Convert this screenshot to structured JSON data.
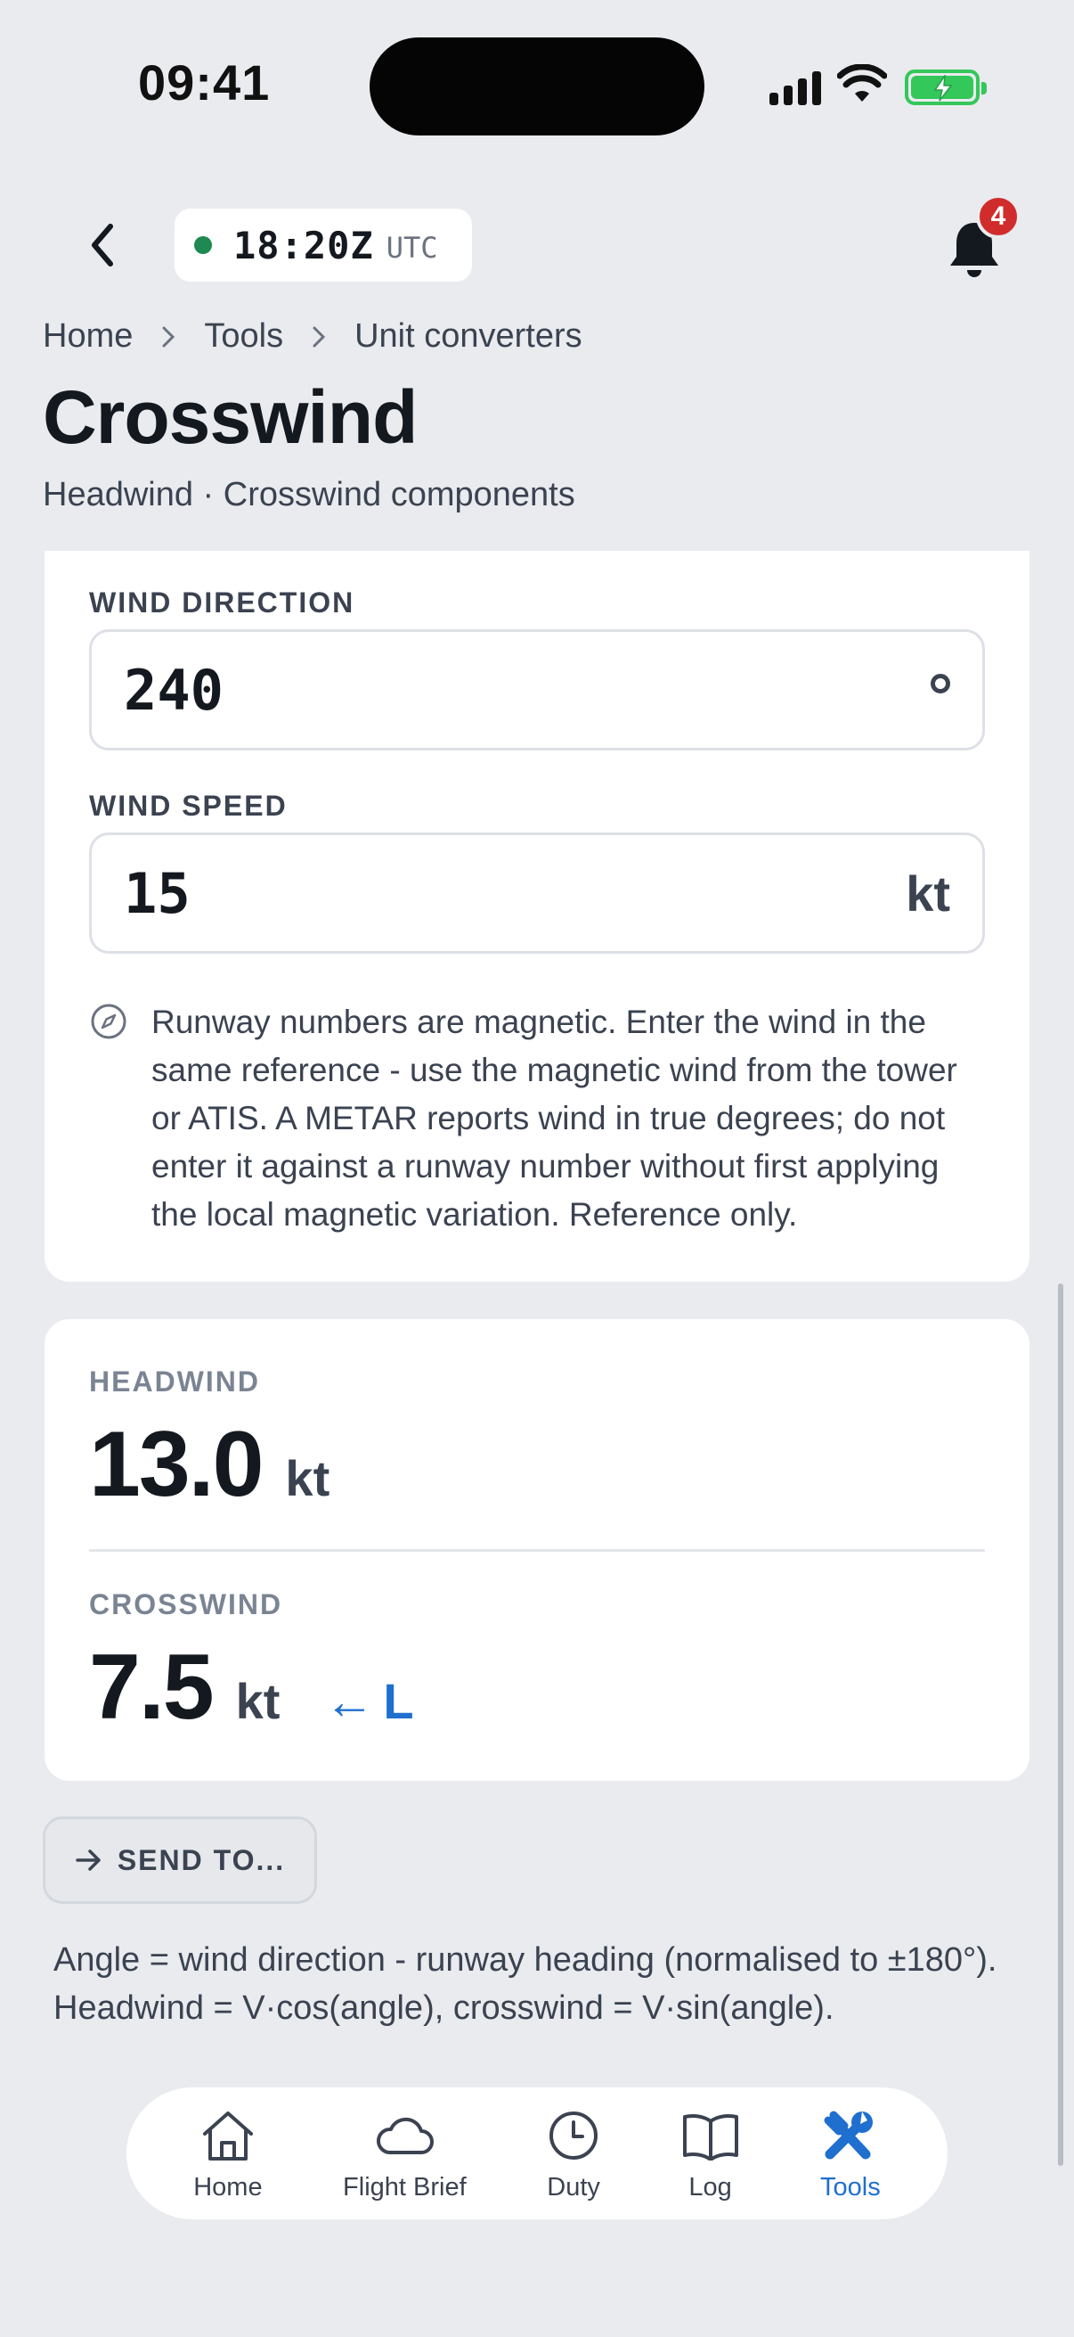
{
  "status_bar": {
    "time": "09:41"
  },
  "header": {
    "clock_time": "18:20Z",
    "clock_zone": "UTC",
    "notification_count": "4"
  },
  "breadcrumb": {
    "items": [
      "Home",
      "Tools",
      "Unit converters"
    ]
  },
  "page": {
    "title": "Crosswind",
    "subtitle": "Headwind · Crosswind components"
  },
  "inputs": {
    "wind_direction": {
      "label": "WIND DIRECTION",
      "value": "240",
      "unit_icon": "degree-symbol"
    },
    "wind_speed": {
      "label": "WIND SPEED",
      "value": "15",
      "unit": "kt"
    },
    "note": "Runway numbers are magnetic. Enter the wind in the same reference - use the magnetic wind from the tower or ATIS. A METAR reports wind in true degrees; do not enter it against a runway number without first applying the local magnetic variation. Reference only.",
    "note_icon": "compass-icon"
  },
  "results": {
    "headwind": {
      "label": "HEADWIND",
      "value": "13.0",
      "unit": "kt"
    },
    "crosswind": {
      "label": "CROSSWIND",
      "value": "7.5",
      "unit": "kt",
      "direction_arrow": "←",
      "direction": "L"
    }
  },
  "actions": {
    "send_label": "SEND TO..."
  },
  "formula": "Angle = wind direction - runway heading (normalised to ±180°). Headwind = V·cos(angle), crosswind = V·sin(angle).",
  "nav": {
    "items": [
      {
        "label": "Home",
        "icon": "home-icon"
      },
      {
        "label": "Flight Brief",
        "icon": "cloud-icon"
      },
      {
        "label": "Duty",
        "icon": "clock-icon"
      },
      {
        "label": "Log",
        "icon": "book-icon"
      },
      {
        "label": "Tools",
        "icon": "tools-icon",
        "active": true
      }
    ]
  },
  "colors": {
    "background": "#e9ebef",
    "accent": "#1f6fcf",
    "status_ok": "#1e8a52",
    "badge": "#d12c2c",
    "battery": "#34c759"
  }
}
